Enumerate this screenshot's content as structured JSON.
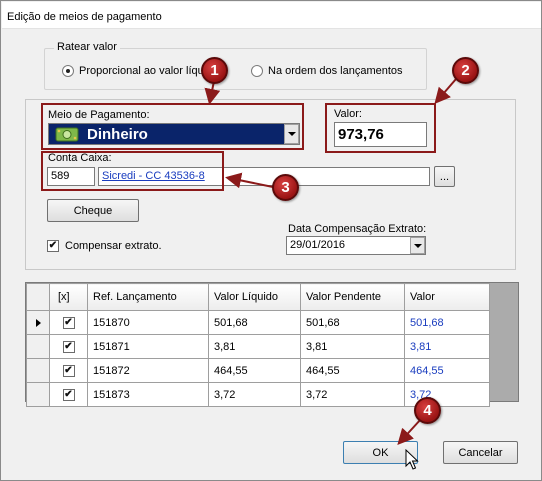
{
  "window": {
    "title": "Edição de meios de pagamento"
  },
  "ratear": {
    "legend": "Ratear valor",
    "option_proporcional": "Proporcional ao valor líqu",
    "option_ordem": "Na ordem dos lançamentos",
    "selected": "proporcional"
  },
  "meio": {
    "label": "Meio de Pagamento:",
    "value": "Dinheiro",
    "icon": "money-bill-icon"
  },
  "valor": {
    "label": "Valor:",
    "value": "973,76"
  },
  "conta": {
    "label": "Conta Caixa:",
    "code": "589",
    "description": "Sicredi - CC 43536-8",
    "browse_label": "..."
  },
  "buttons": {
    "cheque": "Cheque",
    "ok": "OK",
    "cancel": "Cancelar"
  },
  "compensar": {
    "label": "Compensar extrato.",
    "checked": true
  },
  "data_compensacao": {
    "label": "Data Compensação Extrato:",
    "value": "29/01/2016"
  },
  "grid": {
    "columns": [
      "[x]",
      "Ref. Lançamento",
      "Valor Líquido",
      "Valor Pendente",
      "Valor"
    ],
    "rows": [
      {
        "checked": "✔",
        "ref": "151870",
        "liquido": "501,68",
        "pendente": "501,68",
        "valor": "501,68"
      },
      {
        "checked": "✔",
        "ref": "151871",
        "liquido": "3,81",
        "pendente": "3,81",
        "valor": "3,81"
      },
      {
        "checked": "✔",
        "ref": "151872",
        "liquido": "464,55",
        "pendente": "464,55",
        "valor": "464,55"
      },
      {
        "checked": "✔",
        "ref": "151873",
        "liquido": "3,72",
        "pendente": "3,72",
        "valor": "3,72"
      }
    ]
  },
  "annotations": {
    "b1": "1",
    "b2": "2",
    "b3": "3",
    "b4": "4",
    "color": "#8b1a1a"
  },
  "colors": {
    "selection": "#0a246a",
    "link": "#1a3dbf",
    "annotation": "#8b1a1a"
  }
}
